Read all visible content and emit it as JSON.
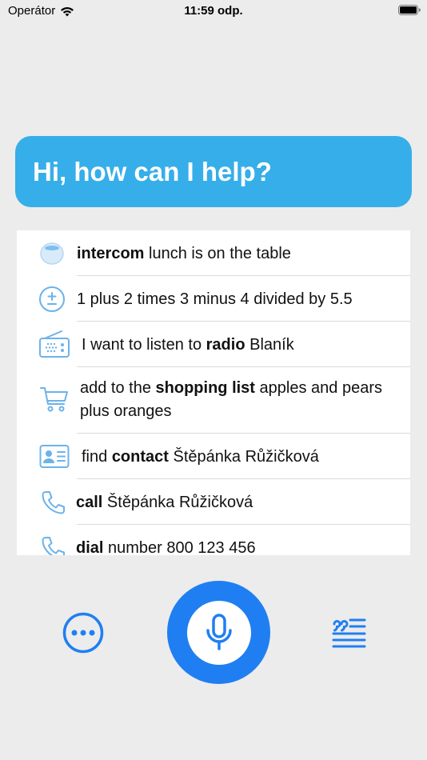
{
  "status_bar": {
    "carrier": "Operátor",
    "time": "11:59 odp."
  },
  "greeting": "Hi, how can I help?",
  "examples": [
    {
      "icon": "homepod-icon",
      "bold": "intercom",
      "pre": "",
      "post": " lunch is on the table"
    },
    {
      "icon": "plus-minus-icon",
      "bold": "",
      "pre": "1 plus 2 times 3 minus 4 divided by 5.5",
      "post": ""
    },
    {
      "icon": "radio-icon",
      "bold": "radio",
      "pre": "I want to listen to ",
      "post": " Blaník"
    },
    {
      "icon": "cart-icon",
      "bold": "shopping list",
      "pre": "add to the ",
      "post": " apples and pears plus oranges"
    },
    {
      "icon": "contact-card-icon",
      "bold": "contact",
      "pre": "find ",
      "post": " Štěpánka Růžičková"
    },
    {
      "icon": "phone-icon",
      "bold": "call",
      "pre": "",
      "post": " Štěpánka Růžičková"
    },
    {
      "icon": "phone-icon",
      "bold": "dial",
      "pre": "",
      "post": " number 800 123 456"
    }
  ],
  "colors": {
    "accent": "#1f7ff2",
    "banner": "#36aee9",
    "icon": "#6bb3ea",
    "background": "#ececec"
  }
}
